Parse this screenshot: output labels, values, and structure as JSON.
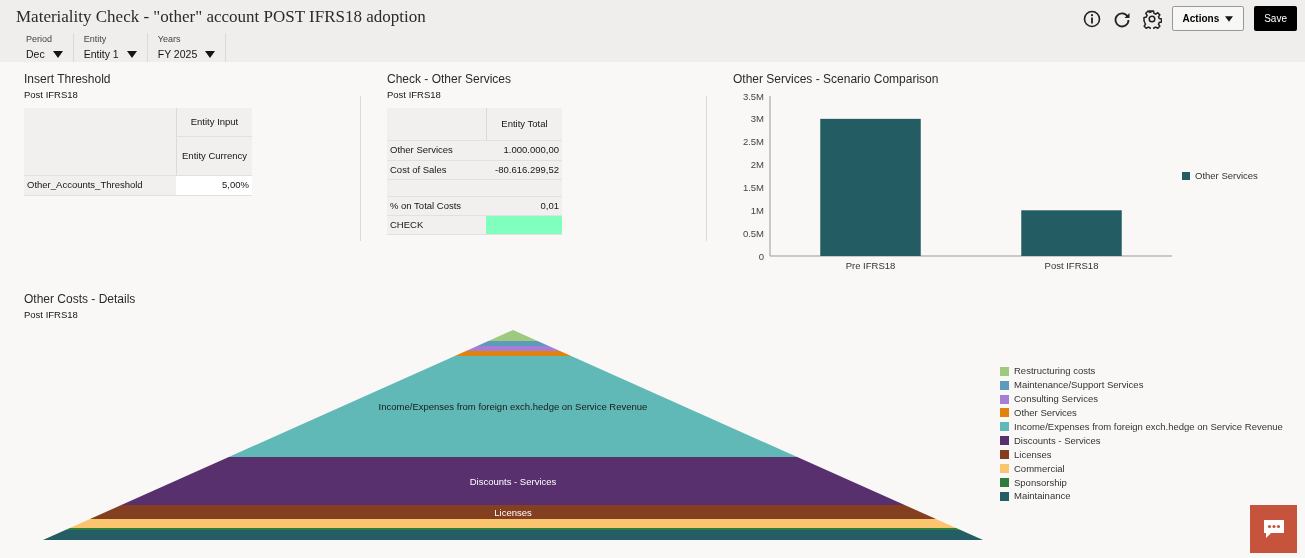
{
  "header": {
    "title": "Materiality Check - \"other\" account POST IFRS18 adoption",
    "filters": [
      {
        "label": "Period",
        "value": "Dec"
      },
      {
        "label": "Entity",
        "value": "Entity 1"
      },
      {
        "label": "Years",
        "value": "FY 2025"
      }
    ],
    "actions_button": "Actions",
    "save_button": "Save"
  },
  "threshold_panel": {
    "title": "Insert Threshold",
    "subtitle": "Post IFRS18",
    "columns": [
      "Entity Input",
      "Entity Currency"
    ],
    "rows": [
      {
        "label": "Other_Accounts_Threshold",
        "value": "5,00%"
      }
    ]
  },
  "check_panel": {
    "title": "Check - Other Services",
    "subtitle": "Post IFRS18",
    "column": "Entity Total",
    "rows": [
      {
        "kind": "data",
        "label": "Other Services",
        "value": "1.000.000,00"
      },
      {
        "kind": "data",
        "label": "Cost of Sales",
        "value": "-80.616.299,52"
      },
      {
        "kind": "blank"
      },
      {
        "kind": "data",
        "label": "% on Total Costs",
        "value": "0,01"
      },
      {
        "kind": "status",
        "label": "CHECK",
        "color": "#80ffbf"
      }
    ]
  },
  "comparison_panel": {
    "title": "Other Services - Scenario Comparison",
    "chart_data": {
      "type": "bar",
      "categories": [
        "Pre IFRS18",
        "Post IFRS18"
      ],
      "series": [
        {
          "name": "Other Services",
          "color": "#245c63",
          "values": [
            3000000,
            1000000
          ]
        }
      ],
      "ylim": [
        0,
        3500000
      ],
      "yticks": [
        {
          "value": 0,
          "label": "0"
        },
        {
          "value": 500000,
          "label": "0.5M"
        },
        {
          "value": 1000000,
          "label": "1M"
        },
        {
          "value": 1500000,
          "label": "1.5M"
        },
        {
          "value": 2000000,
          "label": "2M"
        },
        {
          "value": 2500000,
          "label": "2.5M"
        },
        {
          "value": 3000000,
          "label": "3M"
        },
        {
          "value": 3500000,
          "label": "3.5M"
        }
      ]
    }
  },
  "details_panel": {
    "title": "Other Costs - Details",
    "subtitle": "Post IFRS18",
    "segments": [
      {
        "name": "Restructuring costs",
        "color": "#9fc97f"
      },
      {
        "name": "Maintenance/Support Services",
        "color": "#5e9bbb"
      },
      {
        "name": "Consulting Services",
        "color": "#a57fd5"
      },
      {
        "name": "Other Services",
        "color": "#e1820f"
      },
      {
        "name": "Income/Expenses from foreign exch.hedge on Service Revenue",
        "color": "#60b9b6",
        "label": "Income/Expenses from foreign exch.hedge on Service Revenue"
      },
      {
        "name": "Discounts - Services",
        "color": "#58306e",
        "label": "Discounts - Services"
      },
      {
        "name": "Licenses",
        "color": "#843f20",
        "label": "Licenses"
      },
      {
        "name": "Commercial",
        "color": "#fbc46e"
      },
      {
        "name": "Sponsorship",
        "color": "#2e7d3c"
      },
      {
        "name": "Maintainance",
        "color": "#245e64"
      }
    ]
  }
}
